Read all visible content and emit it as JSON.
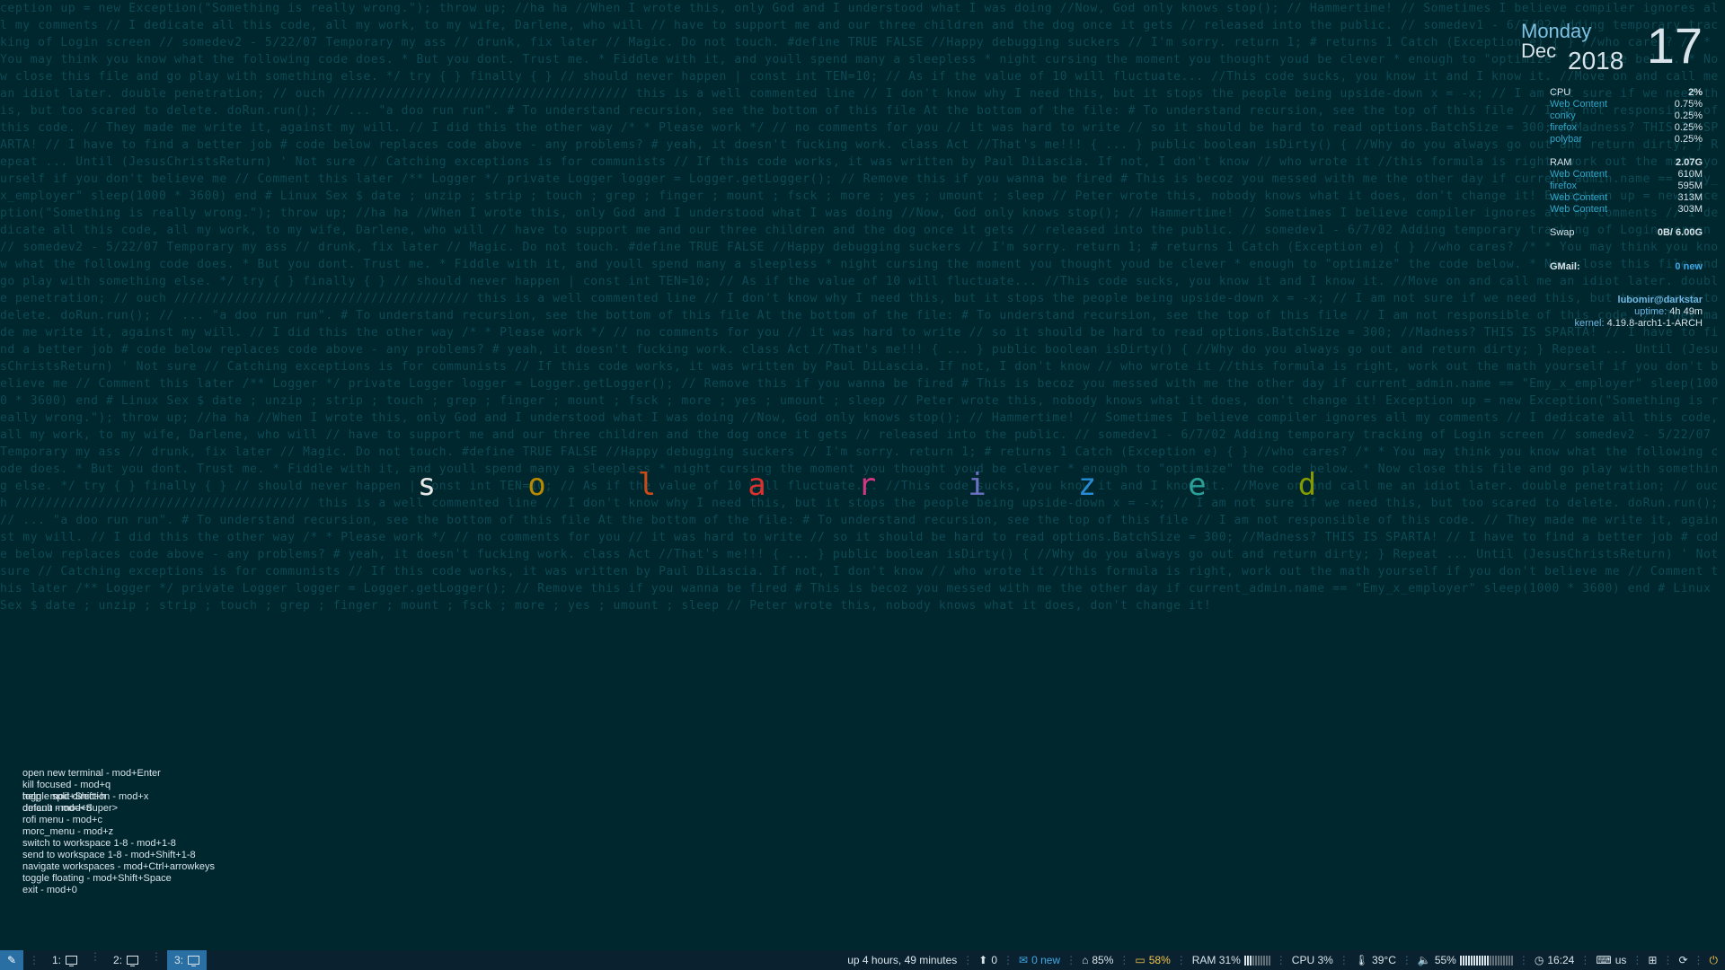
{
  "wallpaper_text": "ception up = new Exception(\"Something is really wrong.\"); throw up; //ha ha //When I wrote this, only God and I understood what I was doing //Now, God only knows stop(); // Hammertime! // Sometimes I believe compiler ignores all my comments // I dedicate all this code, all my work, to my wife, Darlene, who will // have to support me and our three children and the dog once it gets // released into the public. // somedev1 - 6/7/02 Adding temporary tracking of Login screen // somedev2 - 5/22/07 Temporary my ass // drunk, fix later // Magic. Do not touch. #define TRUE FALSE //Happy debugging suckers // I'm sorry. return 1; # returns 1 Catch (Exception e) { } //who cares? /* * You may think you know what the following code does. * But you dont. Trust me. * Fiddle with it, and youll spend many a sleepless * night cursing the moment you thought youd be clever * enough to \"optimize\" the code below. * Now close this file and go play with something else. */ try { } finally { } // should never happen | const int TEN=10; // As if the value of 10 will fluctuate... //This code sucks, you know it and I know it. //Move on and call me an idiot later. double penetration; // ouch /////////////////////////////////////// this is a well commented line // I don't know why I need this, but it stops the people being upside-down x = -x; // I am not sure if we need this, but too scared to delete. doRun.run(); // ... \"a doo run run\". # To understand recursion, see the bottom of this file At the bottom of the file: # To understand recursion, see the top of this file // I am not responsible of this code. // They made me write it, against my will. // I did this the other way /* * Please work */ // no comments for you // it was hard to write // so it should be hard to read options.BatchSize = 300; //Madness? THIS IS SPARTA! // I have to find a better job # code below replaces code above - any problems? # yeah, it doesn't fucking work. class Act //That's me!!! { ... } public boolean isDirty() { //Why do you always go out and return dirty; } Repeat ... Until (JesusChristsReturn) ' Not sure // Catching exceptions is for communists // If this code works, it was written by Paul DiLascia. If not, I don't know // who wrote it //this formula is right, work out the math yourself if you don't believe me // Comment this later /** Logger */ private Logger logger = Logger.getLogger(); // Remove this if you wanna be fired # This is becoz you messed with me the other day if current_admin.name == \"Emy_x_employer\" sleep(1000 * 3600) end # Linux Sex $ date ; unzip ; strip ; touch ; grep ; finger ; mount ; fsck ; more ; yes ; umount ; sleep // Peter wrote this, nobody knows what it does, don't change it! Exception up = new Exception(\"Something is really wrong.\"); throw up; //ha ha //When I wrote this, only God and I understood what I was doing //Now, God only knows stop(); // Hammertime! // Sometimes I believe compiler ignores all my comments // I dedicate all this code, all my work, to my wife, Darlene, who will // have to support me and our three children and the dog once it gets // released into the public. // somedev1 - 6/7/02 Adding temporary tracking of Login screen // somedev2 - 5/22/07 Temporary my ass // drunk, fix later // Magic. Do not touch. #define TRUE FALSE //Happy debugging suckers // I'm sorry. return 1; # returns 1 Catch (Exception e) { } //who cares? /* * You may think you know what the following code does. * But you dont. Trust me. * Fiddle with it, and youll spend many a sleepless * night cursing the moment you thought youd be clever * enough to \"optimize\" the code below. * Now close this file and go play with something else. */ try { } finally { } // should never happen | const int TEN=10; // As if the value of 10 will fluctuate... //This code sucks, you know it and I know it. //Move on and call me an idiot later. double penetration; // ouch /////////////////////////////////////// this is a well commented line // I don't know why I need this, but it stops the people being upside-down x = -x; // I am not sure if we need this, but too scared to delete. doRun.run(); // ... \"a doo run run\". # To understand recursion, see the bottom of this file At the bottom of the file: # To understand recursion, see the top of this file // I am not responsible of this code. // They made me write it, against my will. // I did this the other way /* * Please work */ // no comments for you // it was hard to write // so it should be hard to read options.BatchSize = 300; //Madness? THIS IS SPARTA! // I have to find a better job # code below replaces code above - any problems? # yeah, it doesn't fucking work. class Act //That's me!!! { ... } public boolean isDirty() { //Why do you always go out and return dirty; } Repeat ... Until (JesusChristsReturn) ' Not sure // Catching exceptions is for communists // If this code works, it was written by Paul DiLascia. If not, I don't know // who wrote it //this formula is right, work out the math yourself if you don't believe me // Comment this later /** Logger */ private Logger logger = Logger.getLogger(); // Remove this if you wanna be fired # This is becoz you messed with me the other day if current_admin.name == \"Emy_x_employer\" sleep(1000 * 3600) end # Linux Sex $ date ; unzip ; strip ; touch ; grep ; finger ; mount ; fsck ; more ; yes ; umount ; sleep // Peter wrote this, nobody knows what it does, don't change it! Exception up = new Exception(\"Something is really wrong.\"); throw up; //ha ha //When I wrote this, only God and I understood what I was doing //Now, God only knows stop(); // Hammertime! // Sometimes I believe compiler ignores all my comments // I dedicate all this code, all my work, to my wife, Darlene, who will // have to support me and our three children and the dog once it gets // released into the public. // somedev1 - 6/7/02 Adding temporary tracking of Login screen // somedev2 - 5/22/07 Temporary my ass // drunk, fix later // Magic. Do not touch. #define TRUE FALSE //Happy debugging suckers // I'm sorry. return 1; # returns 1 Catch (Exception e) { } //who cares? /* * You may think you know what the following code does. * But you dont. Trust me. * Fiddle with it, and youll spend many a sleepless * night cursing the moment you thought youd be clever * enough to \"optimize\" the code below. * Now close this file and go play with something else. */ try { } finally { } // should never happen | const int TEN=10; // As if the value of 10 will fluctuate... //This code sucks, you know it and I know it. //Move on and call me an idiot later. double penetration; // ouch /////////////////////////////////////// this is a well commented line // I don't know why I need this, but it stops the people being upside-down x = -x; // I am not sure if we need this, but too scared to delete. doRun.run(); // ... \"a doo run run\". # To understand recursion, see the bottom of this file At the bottom of the file: # To understand recursion, see the top of this file // I am not responsible of this code. // They made me write it, against my will. // I did this the other way /* * Please work */ // no comments for you // it was hard to write // so it should be hard to read options.BatchSize = 300; //Madness? THIS IS SPARTA! // I have to find a better job # code below replaces code above - any problems? # yeah, it doesn't fucking work. class Act //That's me!!! { ... } public boolean isDirty() { //Why do you always go out and return dirty; } Repeat ... Until (JesusChristsReturn) ' Not sure // Catching exceptions is for communists // If this code works, it was written by Paul DiLascia. If not, I don't know // who wrote it //this formula is right, work out the math yourself if you don't believe me // Comment this later /** Logger */ private Logger logger = Logger.getLogger(); // Remove this if you wanna be fired # This is becoz you messed with me the other day if current_admin.name == \"Emy_x_employer\" sleep(1000 * 3600) end # Linux Sex $ date ; unzip ; strip ; touch ; grep ; finger ; mount ; fsck ; more ; yes ; umount ; sleep // Peter wrote this, nobody knows what it does, don't change it!",
  "title": {
    "letters": [
      {
        "char": "s",
        "color": "#e8e8e8"
      },
      {
        "char": "o",
        "color": "#b58900"
      },
      {
        "char": "l",
        "color": "#cb4b16"
      },
      {
        "char": "a",
        "color": "#dc322f"
      },
      {
        "char": "r",
        "color": "#d33682"
      },
      {
        "char": "i",
        "color": "#6c71c4"
      },
      {
        "char": "z",
        "color": "#268bd2"
      },
      {
        "char": "e",
        "color": "#2aa198"
      },
      {
        "char": "d",
        "color": "#859900"
      }
    ]
  },
  "conky": {
    "day_name": "Monday",
    "month": "Dec",
    "year": "2018",
    "day_num": "17",
    "cpu_label": "CPU",
    "cpu_value": "2%",
    "cpu_procs": [
      {
        "name": "Web Content",
        "value": "0.75%"
      },
      {
        "name": "conky",
        "value": "0.25%"
      },
      {
        "name": "firefox",
        "value": "0.25%"
      },
      {
        "name": "polybar",
        "value": "0.25%"
      }
    ],
    "ram_label": "RAM",
    "ram_value": "2.07G",
    "ram_procs": [
      {
        "name": "Web Content",
        "value": "610M"
      },
      {
        "name": "firefox",
        "value": "595M"
      },
      {
        "name": "Web Content",
        "value": "313M"
      },
      {
        "name": "Web Content",
        "value": "303M"
      }
    ],
    "swap_label": "Swap",
    "swap_value": "0B/ 6.00G",
    "gmail_label": "GMail:",
    "gmail_value": "0 new",
    "user": "lubomir@darkstar",
    "uptime_label": "uptime:",
    "uptime_value": "4h 49m",
    "kernel_label": "kernel:",
    "kernel_value": "4.19.8-arch1-1-ARCH"
  },
  "keys": {
    "lines": [
      "open new terminal - mod+Enter",
      "kill focused - mod+q",
      "toggle split direction - mod+x",
      "dmenu - mod+d",
      "rofi menu - mod+c",
      "morc_menu - mod+z",
      "switch to workspace 1-8 - mod+1-8",
      "send to workspace 1-8 - mod+Shift+1-8",
      "navigate workspaces - mod+Ctrl+arrowkeys",
      "toggle floating - mod+Shift+Space",
      "exit - mod+0"
    ],
    "help": "help - mod+Shift+h",
    "default_mod": "default mod=<Super>"
  },
  "bar": {
    "workspaces": [
      {
        "label": "1:"
      },
      {
        "label": "2:"
      },
      {
        "label": "3:",
        "active": true
      }
    ],
    "uptime": "up 4 hours, 49 minutes",
    "updates": "0",
    "mail": "0 new",
    "home": "85%",
    "battery": "58%",
    "ram": "RAM 31%",
    "ram_level": 0.31,
    "cpu": "CPU 3%",
    "temp": "39°C",
    "volume": "55%",
    "volume_level": 0.55,
    "time": "16:24",
    "keyboard": "us"
  },
  "colors": {
    "accent": "#2a6fa3",
    "background": "#00262e",
    "text": "#d8e4ea",
    "link": "#3ea8e6",
    "warning": "#f3c44e"
  }
}
